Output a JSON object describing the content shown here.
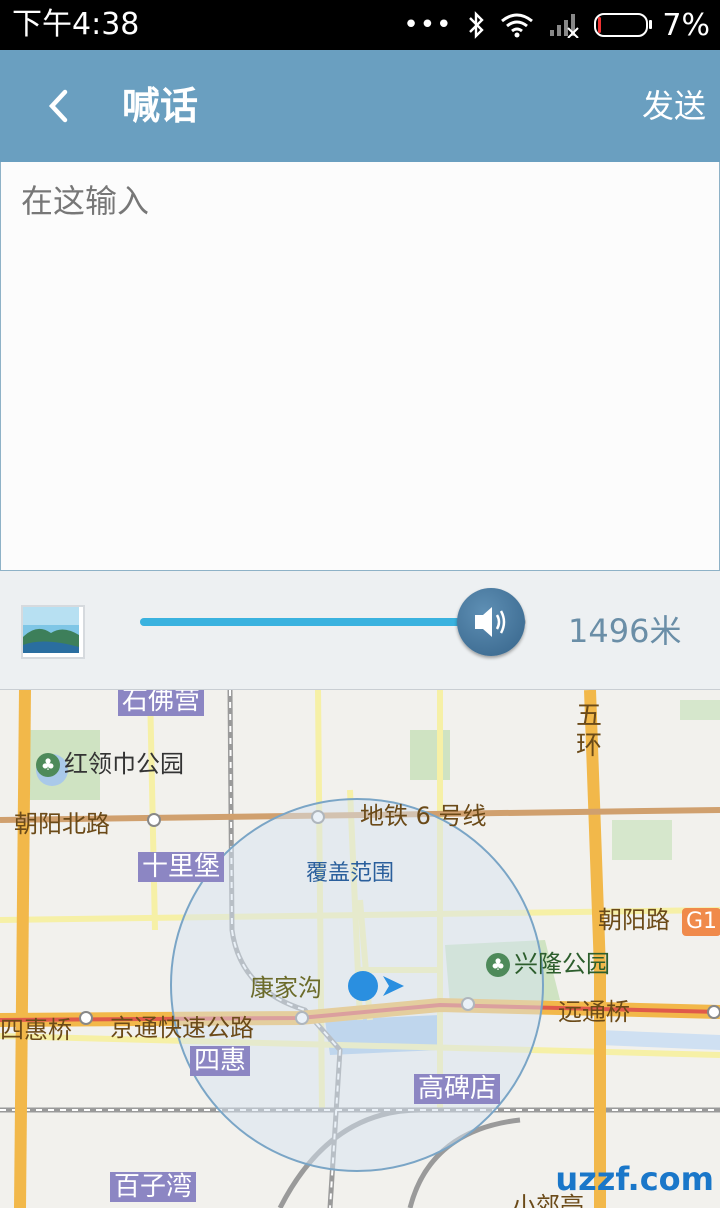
{
  "status_bar": {
    "time": "下午4:38",
    "dots": "•••",
    "battery": "7%"
  },
  "header": {
    "title": "喊话",
    "send": "发送"
  },
  "input": {
    "placeholder": "在这输入",
    "value": ""
  },
  "control": {
    "distance": "1496米",
    "slider_level_fraction": 0.88
  },
  "map": {
    "labels": {
      "shifo": "石佛营",
      "honglingjin": "红领巾公园",
      "chaoyang_north": "朝阳北路",
      "subway6": "地铁 6 号线",
      "shilipu": "十里堡",
      "coverage": "覆盖范围",
      "chaoyang_road": "朝阳路",
      "g1": "G1",
      "xinglong": "兴隆公园",
      "kangjiagou": "康家沟",
      "sihui_bridge": "四惠桥",
      "jingtong": "京通快速公路",
      "yuantong": "远通桥",
      "sihui": "四惠",
      "gaobeidian": "高碑店",
      "baiziwan": "百子湾",
      "fifth_ring_a": "五",
      "fifth_ring_b": "环",
      "bottom_partial": "小郊亭"
    },
    "watermark": "uzzf.com"
  },
  "colors": {
    "header": "#6a9fc0",
    "slider": "#3ab2df",
    "accent": "#2a5f9c"
  }
}
